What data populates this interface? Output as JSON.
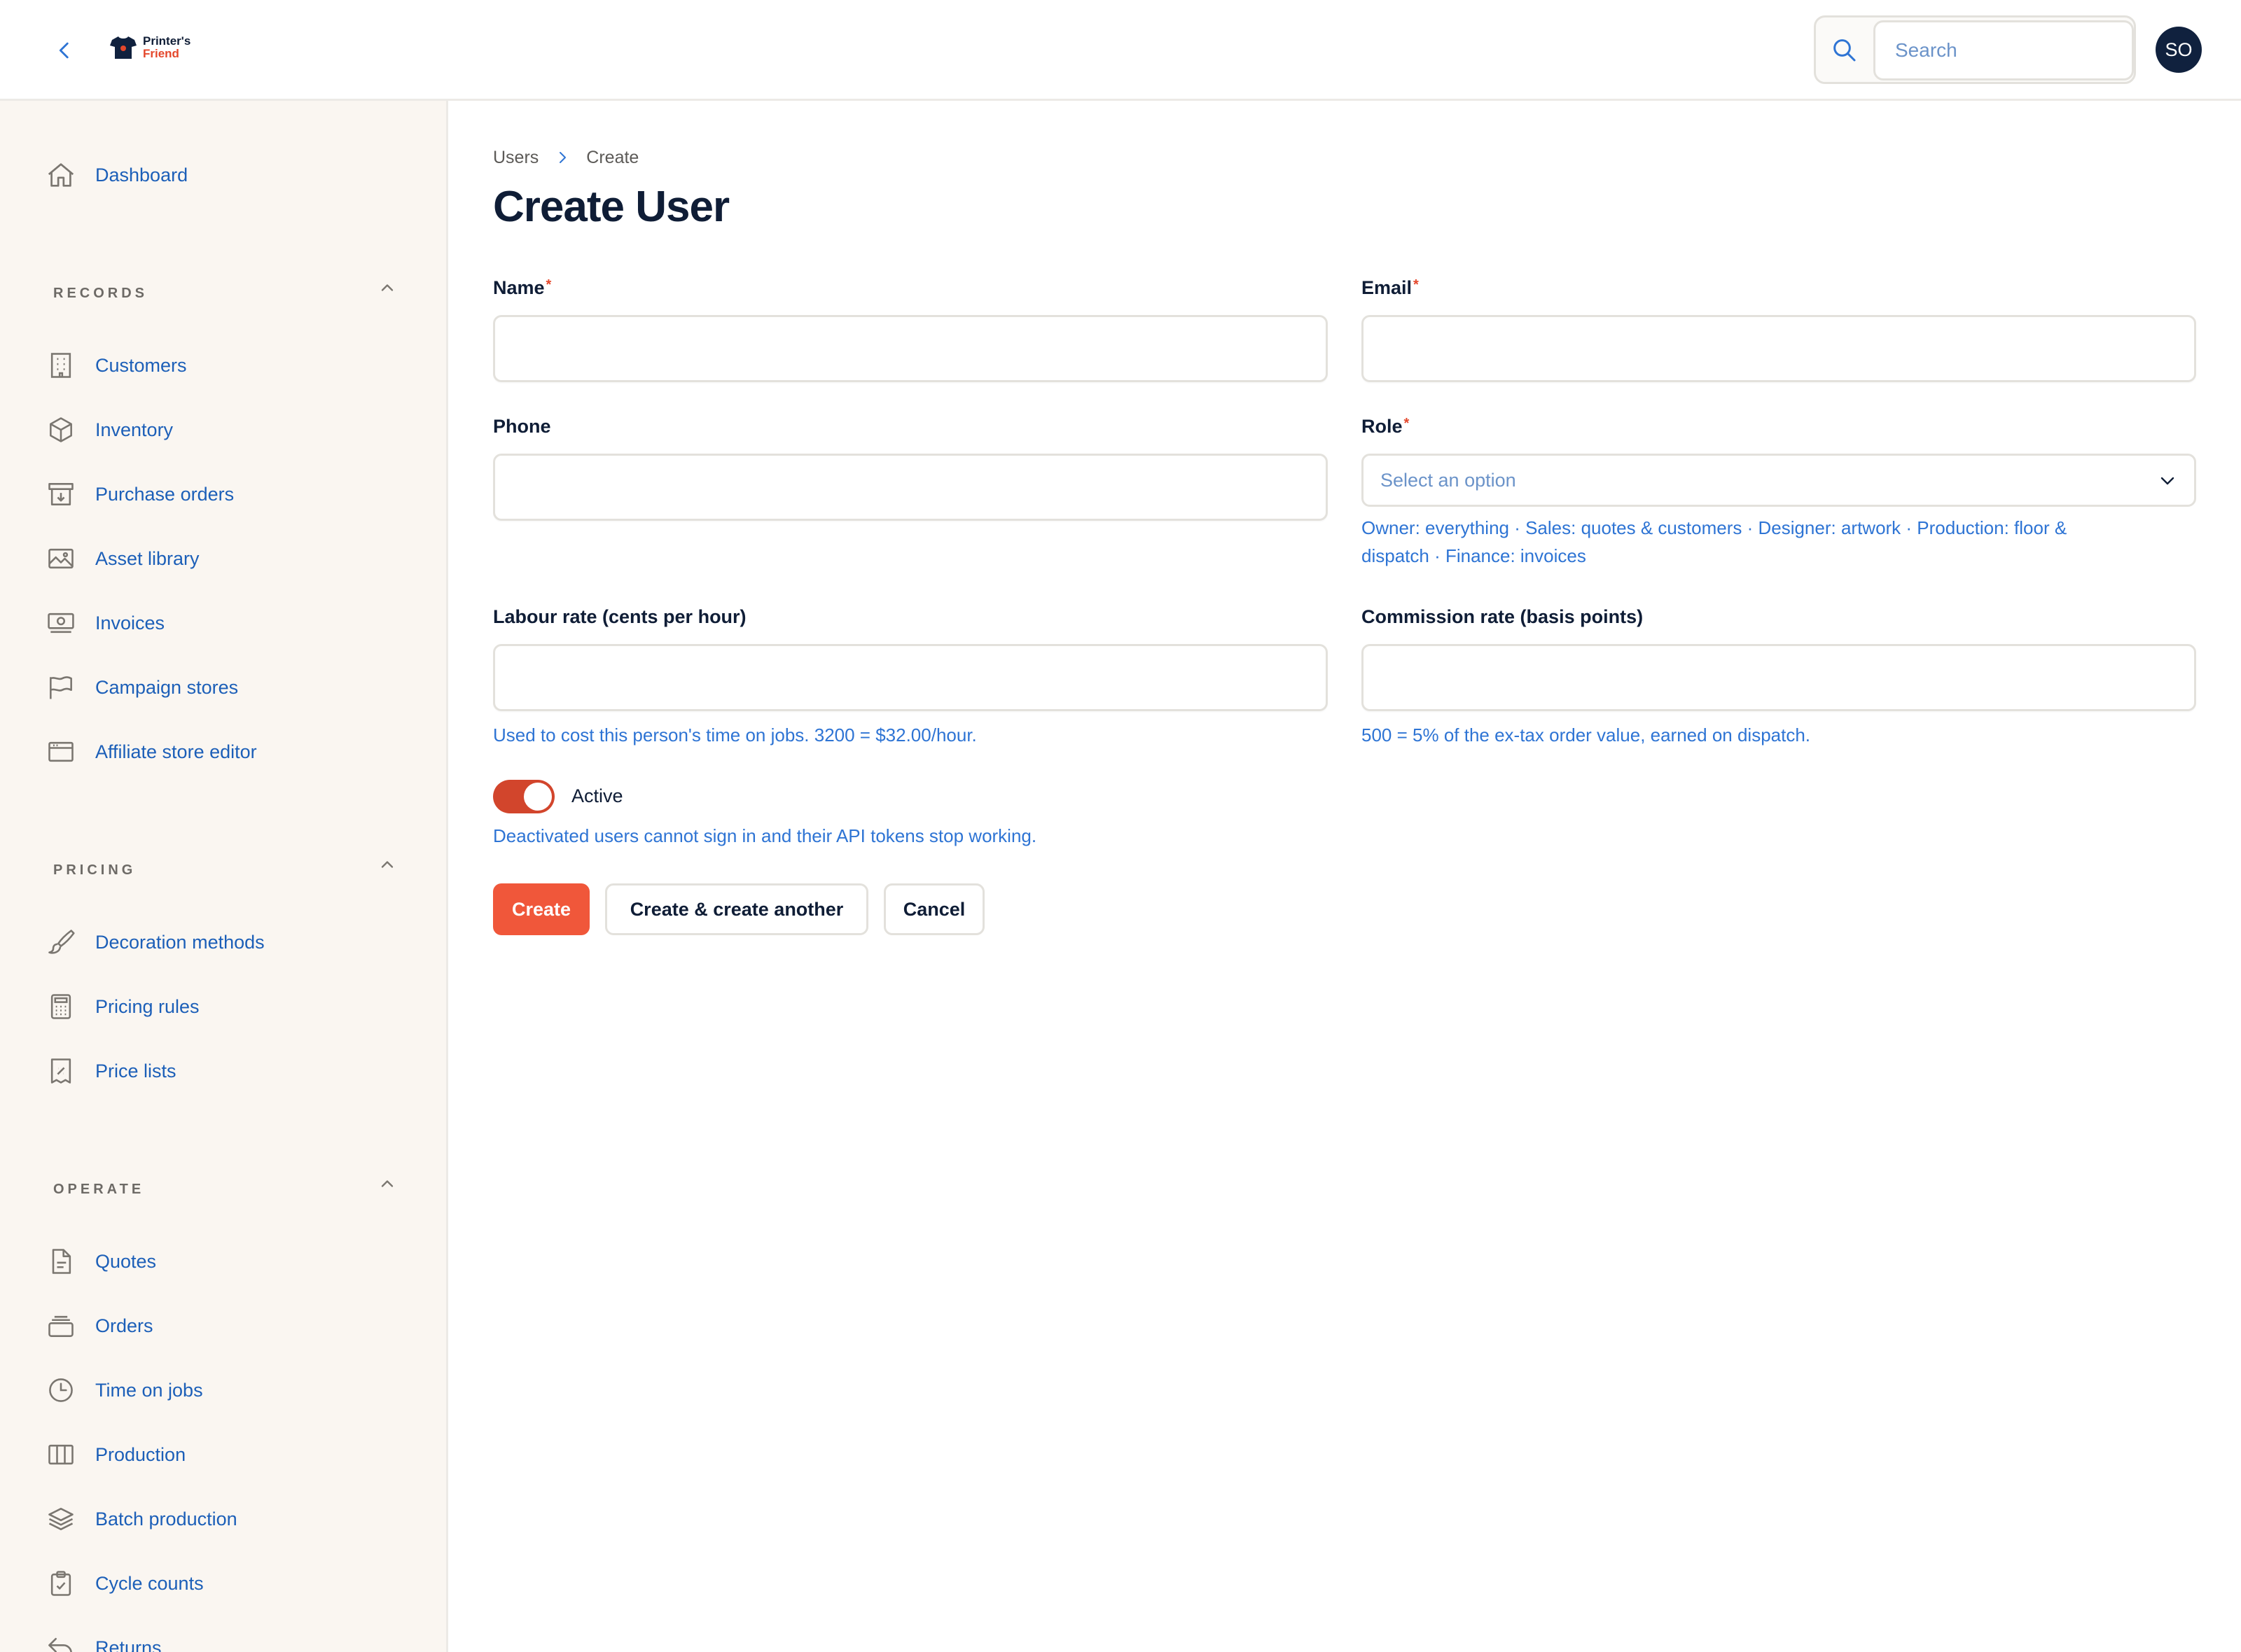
{
  "brand": {
    "name_line1": "Printer's",
    "name_line2": "Friend",
    "accent_color": "#f0573a",
    "navy_color": "#10213e",
    "link_color": "#1c5fb8"
  },
  "header": {
    "back_icon": "chevron-left-icon",
    "search_placeholder": "Search",
    "avatar_initials": "SO"
  },
  "sidebar": {
    "dashboard": {
      "label": "Dashboard",
      "icon": "home-icon"
    },
    "groups": [
      {
        "title": "RECORDS",
        "items": [
          {
            "label": "Customers",
            "icon": "building-icon"
          },
          {
            "label": "Inventory",
            "icon": "cube-icon"
          },
          {
            "label": "Purchase orders",
            "icon": "archive-box-icon"
          },
          {
            "label": "Asset library",
            "icon": "photo-icon"
          },
          {
            "label": "Invoices",
            "icon": "banknotes-icon"
          },
          {
            "label": "Campaign stores",
            "icon": "flag-icon"
          },
          {
            "label": "Affiliate store editor",
            "icon": "browser-window-icon"
          }
        ]
      },
      {
        "title": "PRICING",
        "items": [
          {
            "label": "Decoration methods",
            "icon": "paint-brush-icon"
          },
          {
            "label": "Pricing rules",
            "icon": "calculator-icon"
          },
          {
            "label": "Price lists",
            "icon": "receipt-percent-icon"
          }
        ]
      },
      {
        "title": "OPERATE",
        "items": [
          {
            "label": "Quotes",
            "icon": "document-text-icon"
          },
          {
            "label": "Orders",
            "icon": "stack-icon"
          },
          {
            "label": "Time on jobs",
            "icon": "clock-icon"
          },
          {
            "label": "Production",
            "icon": "columns-icon"
          },
          {
            "label": "Batch production",
            "icon": "layers-icon"
          },
          {
            "label": "Cycle counts",
            "icon": "clipboard-check-icon"
          },
          {
            "label": "Returns",
            "icon": "arrow-uturn-left-icon"
          }
        ]
      }
    ]
  },
  "main": {
    "breadcrumb": [
      "Users",
      "Create"
    ],
    "title": "Create User",
    "form": {
      "name": {
        "label": "Name",
        "required_mark": "*",
        "value": ""
      },
      "email": {
        "label": "Email",
        "required_mark": "*",
        "value": ""
      },
      "phone": {
        "label": "Phone",
        "value": ""
      },
      "role": {
        "label": "Role",
        "required_mark": "*",
        "placeholder": "Select an option",
        "hint_line1": "Owner: everything · Sales: quotes & customers · Designer: artwork · Production: floor &",
        "hint_line2": "dispatch · Finance: invoices"
      },
      "labour_rate": {
        "label": "Labour rate (cents per hour)",
        "value": "",
        "hint": "Used to cost this person's time on jobs. 3200 = $32.00/hour."
      },
      "commission_rate": {
        "label": "Commission rate (basis points)",
        "value": "",
        "hint": "500 = 5% of the ex-tax order value, earned on dispatch."
      },
      "active": {
        "label": "Active",
        "checked": true,
        "hint": "Deactivated users cannot sign in and their API tokens stop working."
      }
    },
    "actions": {
      "create": "Create",
      "create_another": "Create & create another",
      "cancel": "Cancel"
    }
  }
}
